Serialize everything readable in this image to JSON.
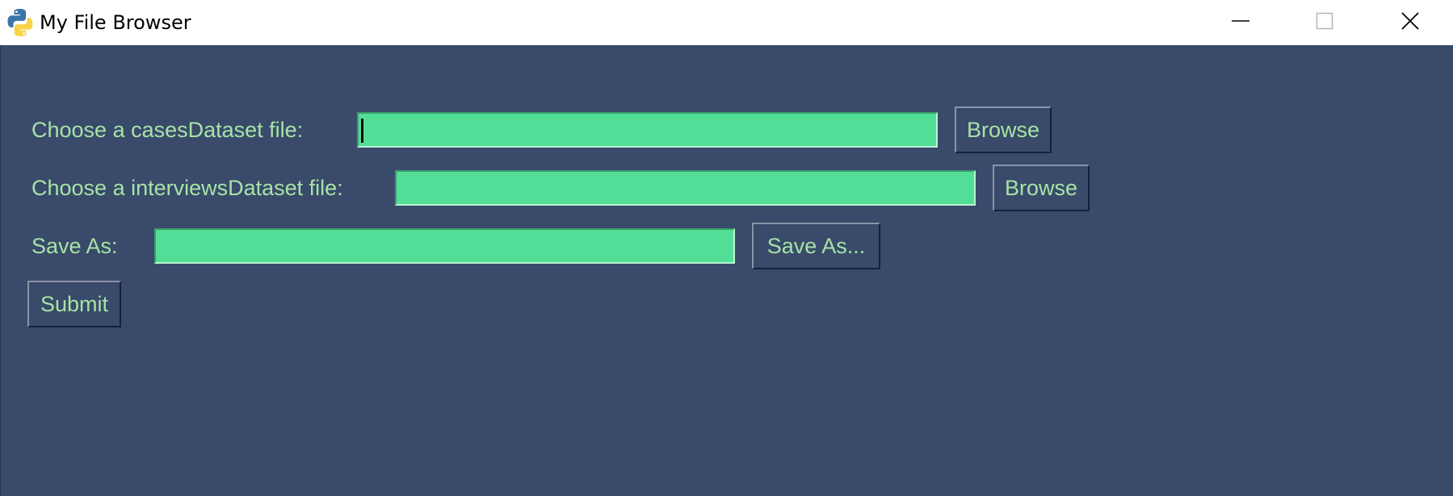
{
  "window": {
    "title": "My File Browser",
    "icon": "python-icon",
    "controls": {
      "minimize_icon": "minimize-icon",
      "maximize_icon": "maximize-icon",
      "close_icon": "close-icon"
    }
  },
  "colors": {
    "background": "#394a6a",
    "text": "#a6e3a6",
    "field": "#52de97"
  },
  "form": {
    "cases": {
      "label": "Choose a casesDataset file:",
      "value": "",
      "button": "Browse"
    },
    "interviews": {
      "label": "Choose a interviewsDataset file:",
      "value": "",
      "button": "Browse"
    },
    "save": {
      "label": "Save As:",
      "value": "",
      "button": "Save As..."
    },
    "submit": "Submit"
  }
}
